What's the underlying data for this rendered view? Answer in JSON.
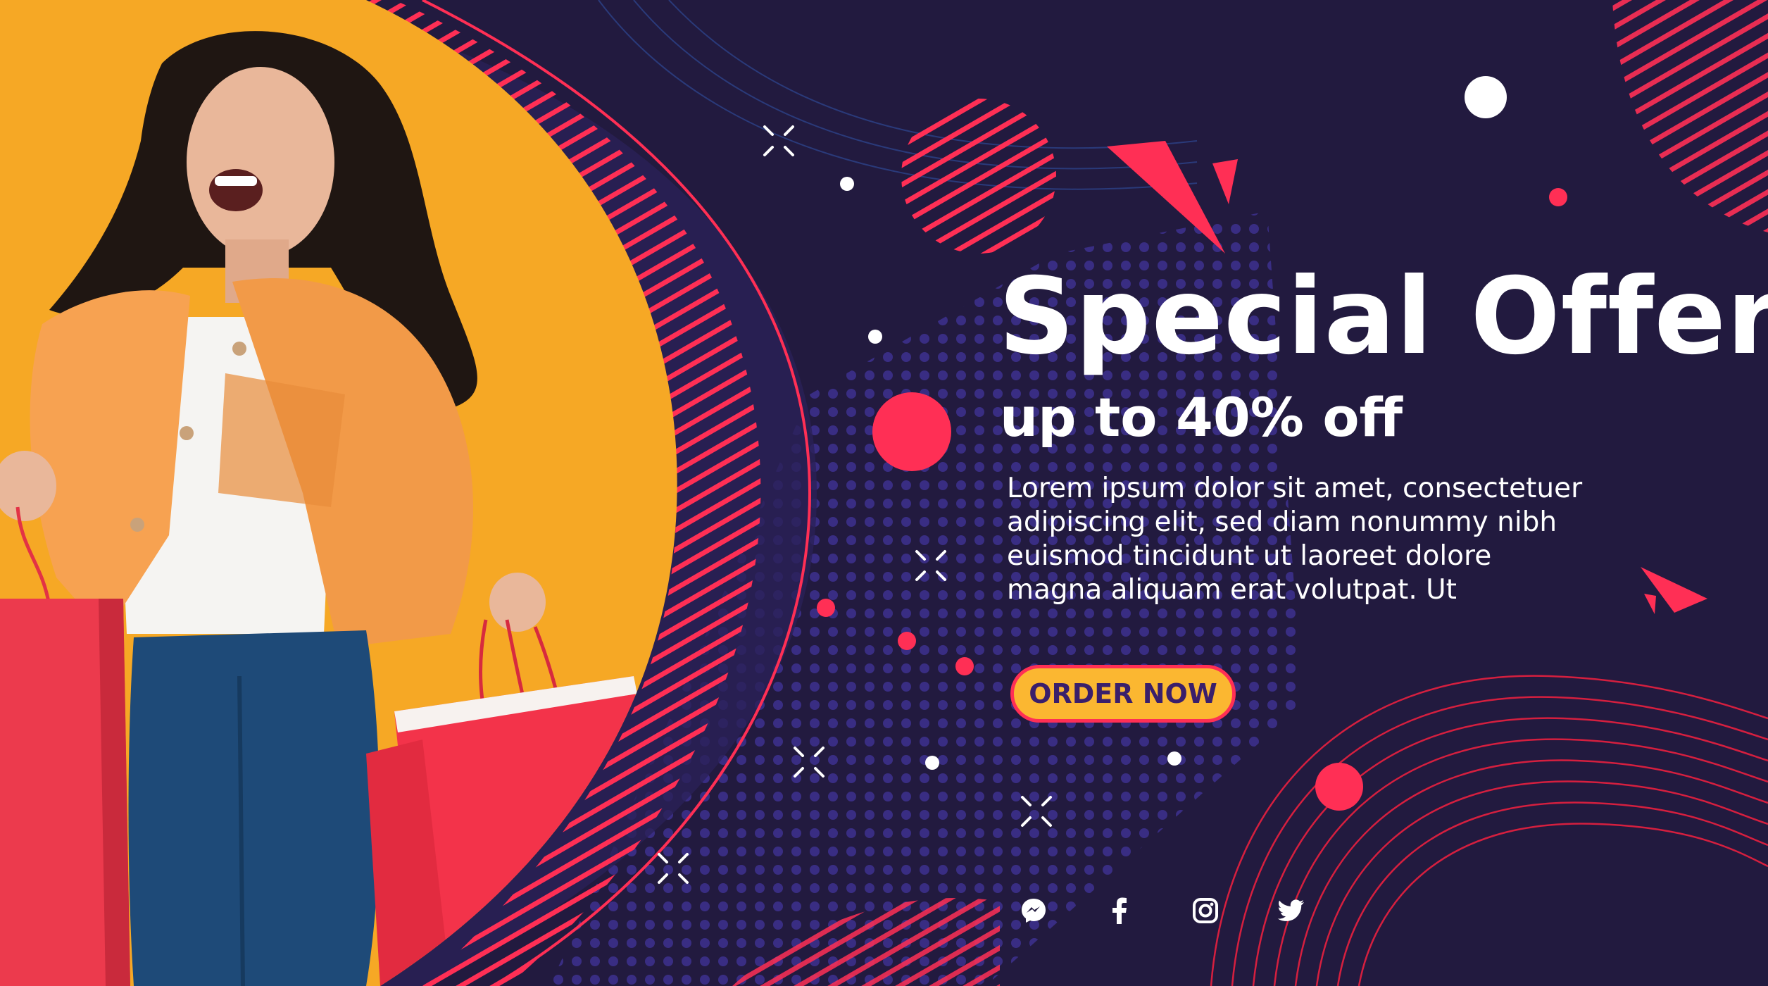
{
  "banner": {
    "headline": "Special Offer",
    "subheadline": "up to 40% off",
    "body": "Lorem ipsum dolor sit amet, consectetuer\nadipiscing elit, sed diam nonummy nibh\neuismod tincidunt ut laoreet dolore\nmagna aliquam erat volutpat. Ut",
    "cta_label": "ORDER NOW"
  },
  "socials": [
    "messenger-icon",
    "facebook-icon",
    "instagram-icon",
    "twitter-icon"
  ],
  "colors": {
    "background": "#221a3f",
    "accent_red": "#ff2f55",
    "accent_yellow": "#fbb731",
    "text": "#ffffff",
    "button_text": "#3a1f6b"
  }
}
